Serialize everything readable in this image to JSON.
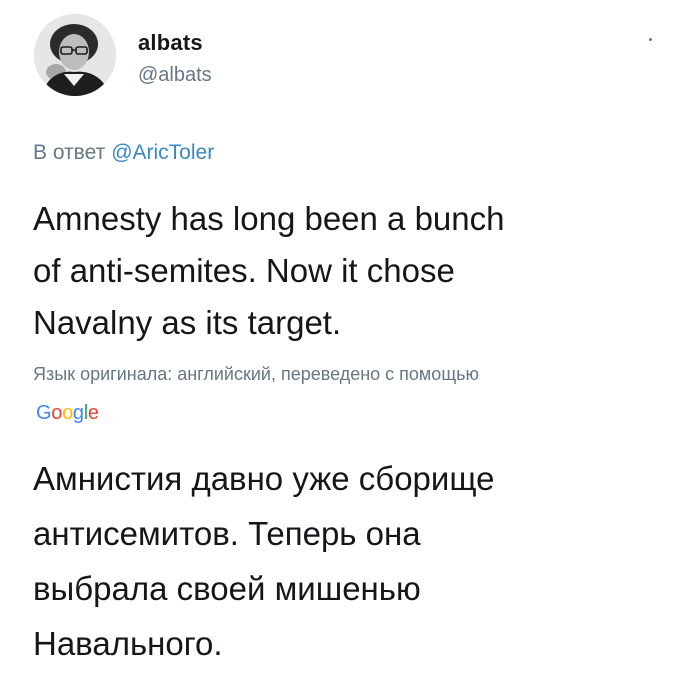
{
  "author": {
    "name": "albats",
    "handle": "@albats",
    "avatar_icon": "profile-photo"
  },
  "reply": {
    "prefix": "В ответ",
    "mention": "@AricToler"
  },
  "tweet": {
    "text_line1": "Amnesty has long been a bunch",
    "text_line2": "of anti-semites. Now it chose",
    "text_line3": "Navalny as its target."
  },
  "translation": {
    "note": "Язык оригинала: английский, переведено с помощью",
    "provider_letters": [
      "G",
      "o",
      "o",
      "g",
      "l",
      "e"
    ],
    "provider_colors": [
      "#4285f4",
      "#ea4335",
      "#fbbc05",
      "#4285f4",
      "#34a853",
      "#ea4335"
    ],
    "text_line1": "Амнистия давно уже сборище",
    "text_line2": "антисемитов. Теперь она",
    "text_line3": "выбрала своей мишенью",
    "text_line4": "Навального."
  },
  "colors": {
    "mention": "#3b88c3",
    "secondary_text": "#657786",
    "primary_text": "#14171a"
  }
}
